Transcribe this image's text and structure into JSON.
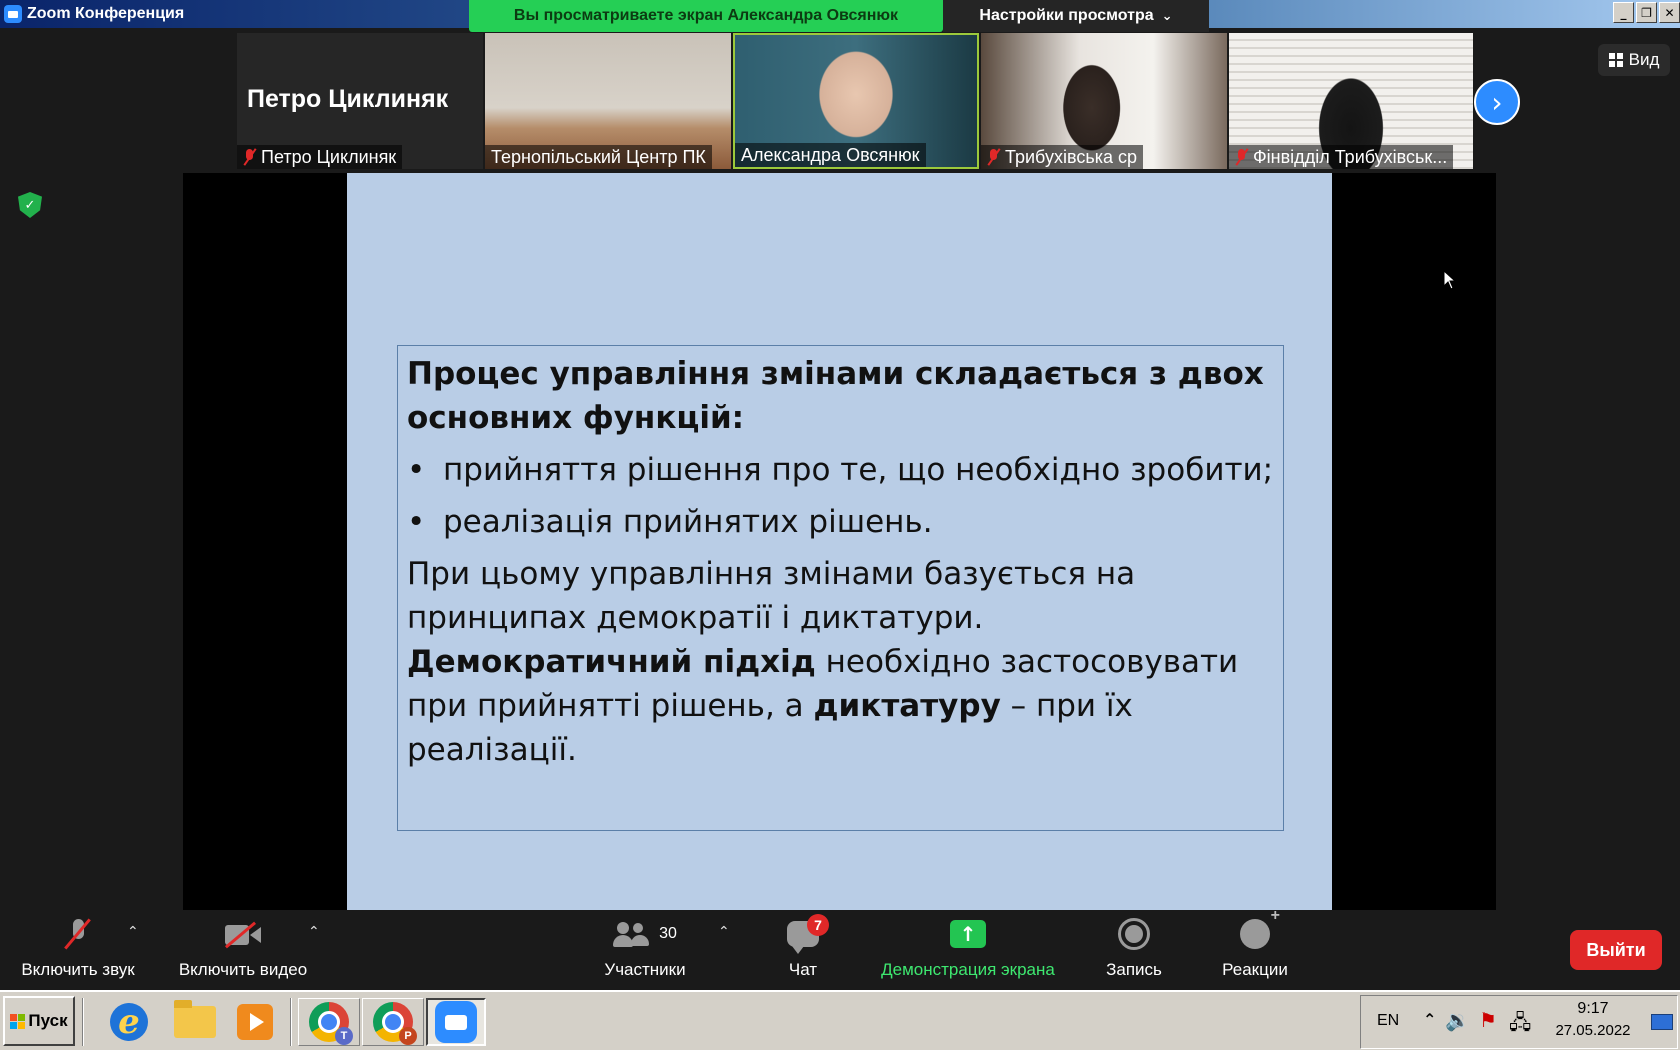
{
  "window": {
    "title": "Zoom Конференция"
  },
  "share_banner": {
    "text": "Вы просматриваете экран Александра Овсянюк"
  },
  "view_options": {
    "label": "Настройки просмотра"
  },
  "view_button": {
    "label": "Вид"
  },
  "participants_strip": [
    {
      "name": "Петро Циклиняк",
      "muted": true,
      "video": false,
      "display_name": "Петро Циклиняк"
    },
    {
      "name": "Тернопільський Центр ПК",
      "muted": false,
      "video": true
    },
    {
      "name": "Александра Овсянюк",
      "muted": false,
      "video": true,
      "speaking": true
    },
    {
      "name": "Трибухівська ср",
      "muted": true,
      "video": true
    },
    {
      "name": "Фінвідділ Трибухівськ...",
      "muted": true,
      "video": true
    }
  ],
  "slide": {
    "heading": "Процес управління змінами складається з двох основних функцій:",
    "bullets": [
      "прийняття рішення про те, що необхідно зробити;",
      "реалізація прийнятих рішень."
    ],
    "para1": "При цьому управління  змінами базується на принципах демократії і диктатури.",
    "para2_bold1": "Демократичний підхід",
    "para2_text1": "  необхідно застосовувати при прийнятті рішень, а ",
    "para2_bold2": "диктатуру",
    "para2_text2": " – при їх реалізації."
  },
  "toolbar": {
    "audio": "Включить звук",
    "video": "Включить видео",
    "participants": "Участники",
    "participants_count": "30",
    "chat": "Чат",
    "chat_badge": "7",
    "share": "Демонстрация экрана",
    "record": "Запись",
    "reactions": "Реакции",
    "leave": "Выйти"
  },
  "taskbar": {
    "start": "Пуск",
    "lang": "EN",
    "time": "9:17",
    "date": "27.05.2022",
    "chrome1_badge": "T",
    "chrome2_badge": "P"
  },
  "colors": {
    "accent": "#2d8cff",
    "share_green": "#23c552",
    "leave_red": "#e02828",
    "slide_bg": "#b9cde6"
  }
}
